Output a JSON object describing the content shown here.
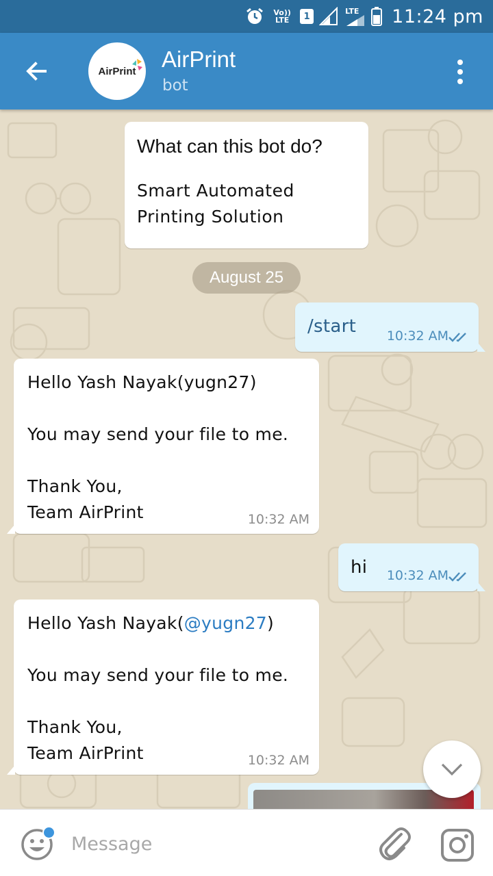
{
  "status_bar": {
    "network_label": "Vo)) LTE",
    "sim_slot": "1",
    "lte_label": "LTE",
    "time": "11:24 pm",
    "icons": [
      "alarm-icon",
      "volte-icon",
      "sim-icon",
      "signal-icon",
      "signal-icon",
      "battery-icon"
    ]
  },
  "header": {
    "avatar_text": "AirPrint",
    "title": "AirPrint",
    "subtitle": "bot",
    "icons": [
      "back-arrow-icon",
      "more-vert-icon"
    ]
  },
  "chat": {
    "bot_info": {
      "title": "What can this bot do?",
      "line1": "Smart Automated",
      "line2": "Printing Solution"
    },
    "date_separator": "August 25",
    "messages": [
      {
        "direction": "out",
        "text": "/start",
        "time": "10:32 AM",
        "status": "read"
      },
      {
        "direction": "in",
        "line1": "Hello Yash Nayak(yugn27)",
        "line2": "You may send your file to me.",
        "line3": "Thank You,",
        "line4": "Team AirPrint",
        "time": "10:32 AM"
      },
      {
        "direction": "out",
        "text": "hi",
        "time": "10:32 AM",
        "status": "read"
      },
      {
        "direction": "in",
        "line1_prefix": "Hello Yash Nayak(",
        "mention": "@yugn27",
        "line1_suffix": ")",
        "line2": "You may send your file to me.",
        "line3": "Thank You,",
        "line4": "Team AirPrint",
        "time": "10:32 AM"
      }
    ]
  },
  "input_bar": {
    "placeholder": "Message",
    "icons": [
      "emoji-icon",
      "attach-icon",
      "camera-icon"
    ]
  },
  "colors": {
    "status_bar": "#2a6c9b",
    "app_bar": "#3a8ac6",
    "chat_bg": "#e6ddc9",
    "outgoing_bubble": "#e1f5fd",
    "accent": "#3d95dd",
    "mention": "#2b7cc2"
  }
}
